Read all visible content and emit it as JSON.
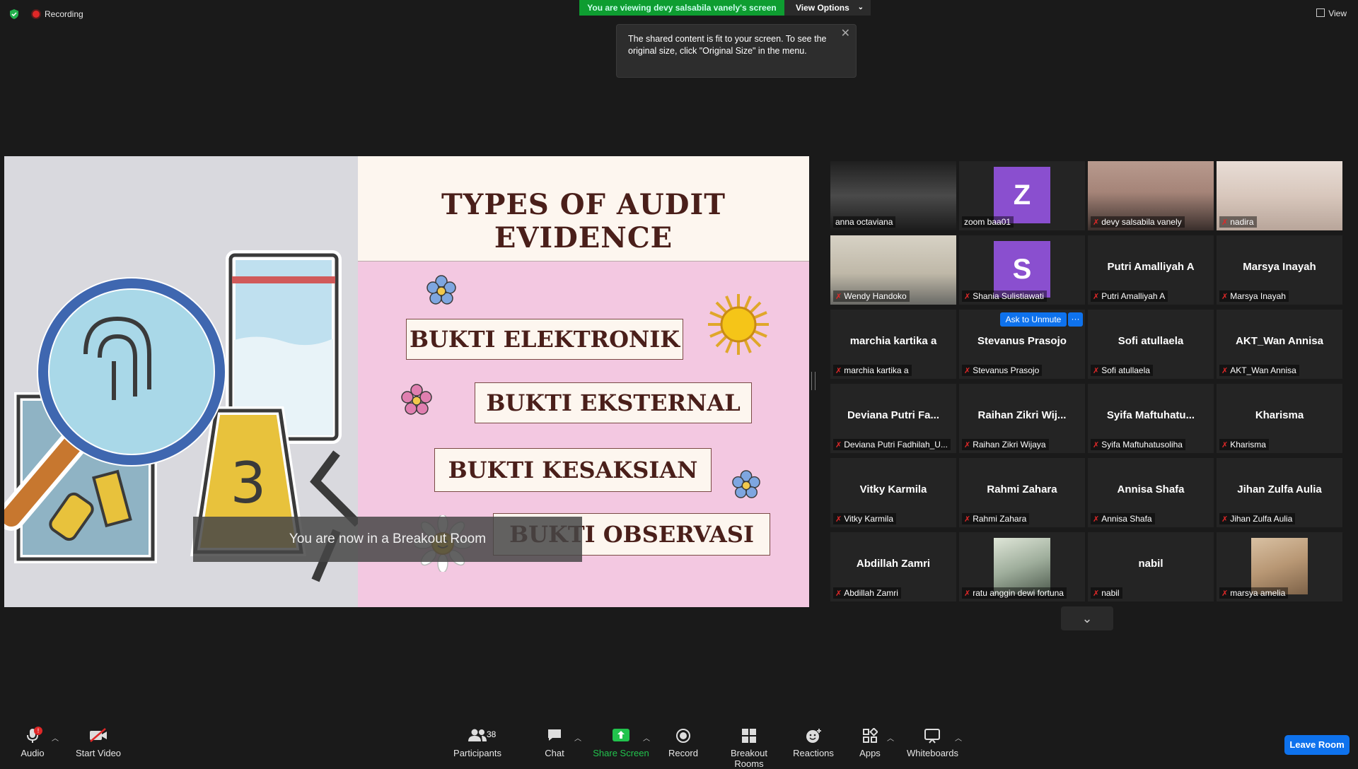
{
  "top_bar": {
    "recording_label": "Recording",
    "viewing_banner": "You are viewing devy salsabila vanely's screen",
    "view_options_label": "View Options",
    "view_label": "View",
    "tooltip_text": "The shared content is fit to your screen. To see the original size, click \"Original Size\" in the menu."
  },
  "slide": {
    "title": "TYPES OF AUDIT EVIDENCE",
    "items": [
      "BUKTI ELEKTRONIK",
      "BUKTI EKSTERNAL",
      "BUKTI KESAKSIAN",
      "BUKTI OBSERVASI"
    ],
    "art_number": "3"
  },
  "breakout_banner": "You are now in a Breakout Room",
  "gallery": {
    "ask_to_unmute": "Ask to Unmute",
    "more": "···",
    "tiles": [
      {
        "name": "",
        "label": "anna octaviana",
        "type": "video"
      },
      {
        "name": "",
        "label": "zoom baa01",
        "type": "avatar",
        "letter": "Z"
      },
      {
        "name": "",
        "label": "devy salsabila vanely",
        "type": "video"
      },
      {
        "name": "",
        "label": "nadira",
        "type": "video"
      },
      {
        "name": "",
        "label": "Wendy Handoko",
        "type": "video"
      },
      {
        "name": "",
        "label": "Shania Sulistiawati",
        "type": "avatar",
        "letter": "S"
      },
      {
        "name": "Putri Amalliyah A",
        "label": "Putri Amalliyah A",
        "type": "name"
      },
      {
        "name": "Marsya Inayah",
        "label": "Marsya Inayah",
        "type": "name"
      },
      {
        "name": "marchia kartika a",
        "label": "marchia kartika a",
        "type": "name"
      },
      {
        "name": "Stevanus Prasojo",
        "label": "Stevanus Prasojo",
        "type": "name"
      },
      {
        "name": "Sofi atullaela",
        "label": "Sofi atullaela",
        "type": "name"
      },
      {
        "name": "AKT_Wan Annisa",
        "label": "AKT_Wan Annisa",
        "type": "name"
      },
      {
        "name": "Deviana  Putri  Fa...",
        "label": "Deviana Putri Fadhilah_U...",
        "type": "name"
      },
      {
        "name": "Raihan  Zikri  Wij...",
        "label": "Raihan Zikri Wijaya",
        "type": "name"
      },
      {
        "name": "Syifa  Maftuhatu...",
        "label": "Syifa Maftuhatusoliha",
        "type": "name"
      },
      {
        "name": "Kharisma",
        "label": "Kharisma",
        "type": "name"
      },
      {
        "name": "Vitky Karmila",
        "label": "Vitky Karmila",
        "type": "name"
      },
      {
        "name": "Rahmi Zahara",
        "label": "Rahmi Zahara",
        "type": "name"
      },
      {
        "name": "Annisa Shafa",
        "label": "Annisa Shafa",
        "type": "name"
      },
      {
        "name": "Jihan Zulfa Aulia",
        "label": "Jihan Zulfa Aulia",
        "type": "name"
      },
      {
        "name": "Abdillah Zamri",
        "label": "Abdillah Zamri",
        "type": "name"
      },
      {
        "name": "",
        "label": "ratu anggin dewi fortuna",
        "type": "photo"
      },
      {
        "name": "nabil",
        "label": "nabil",
        "type": "name"
      },
      {
        "name": "",
        "label": "marsya amelia",
        "type": "photo"
      }
    ]
  },
  "toolbar": {
    "audio": "Audio",
    "start_video": "Start Video",
    "participants": "Participants",
    "participants_count": "38",
    "chat": "Chat",
    "share_screen": "Share Screen",
    "record": "Record",
    "breakout_rooms": "Breakout Rooms",
    "reactions": "Reactions",
    "apps": "Apps",
    "whiteboards": "Whiteboards",
    "leave_room": "Leave Room",
    "audio_badge": "!"
  },
  "colors": {
    "share_banner": "#0e9d31",
    "active_speaker": "#c8e04a",
    "primary_blue": "#0e72ed",
    "muted_red": "#e02828",
    "slide_pink": "#f3c8e1",
    "slide_text": "#4a1f1a"
  }
}
